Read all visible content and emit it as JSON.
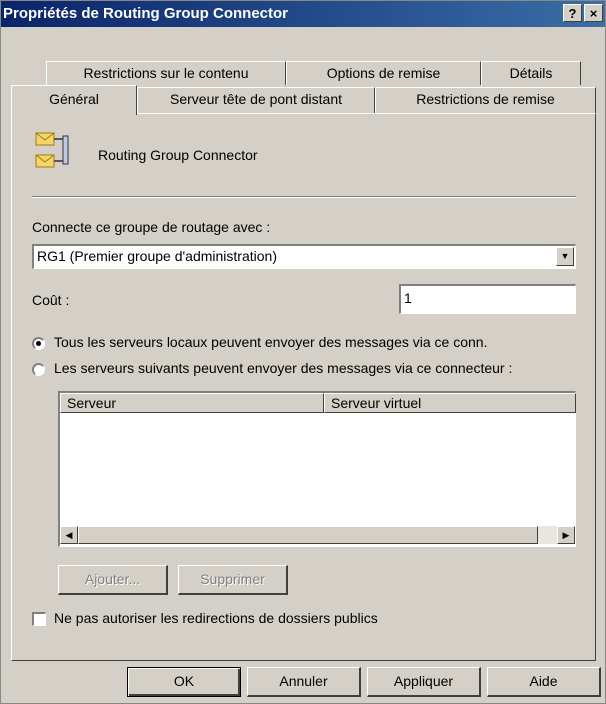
{
  "window": {
    "title": "Propriétés de Routing Group Connector",
    "help_button": "?",
    "close_button": "×"
  },
  "tabs": {
    "row_back": [
      "Restrictions sur le contenu",
      "Options de remise",
      "Détails"
    ],
    "row_front": [
      "Général",
      "Serveur tête de pont distant",
      "Restrictions de remise"
    ],
    "active": "Général"
  },
  "general": {
    "object_name": "Routing Group Connector",
    "connect_label": "Connecte ce groupe de routage avec :",
    "connect_value": "RG1 (Premier groupe d'administration)",
    "cost_label": "Coût :",
    "cost_value": "1",
    "radio_all": "Tous les serveurs locaux peuvent envoyer des messages via ce conn.",
    "radio_some": "Les serveurs suivants peuvent envoyer des messages via ce connecteur :",
    "radio_selected": "all",
    "columns": [
      "Serveur",
      "Serveur virtuel"
    ],
    "rows": [],
    "add_button": "Ajouter...",
    "remove_button": "Supprimer",
    "no_public_folder_label": "Ne pas autoriser les redirections de dossiers publics",
    "no_public_folder_checked": false
  },
  "footer": {
    "ok": "OK",
    "cancel": "Annuler",
    "apply": "Appliquer",
    "help": "Aide"
  },
  "icons": [
    "connector-icon",
    "dropdown-arrow-icon",
    "scroll-left-icon",
    "scroll-right-icon"
  ]
}
